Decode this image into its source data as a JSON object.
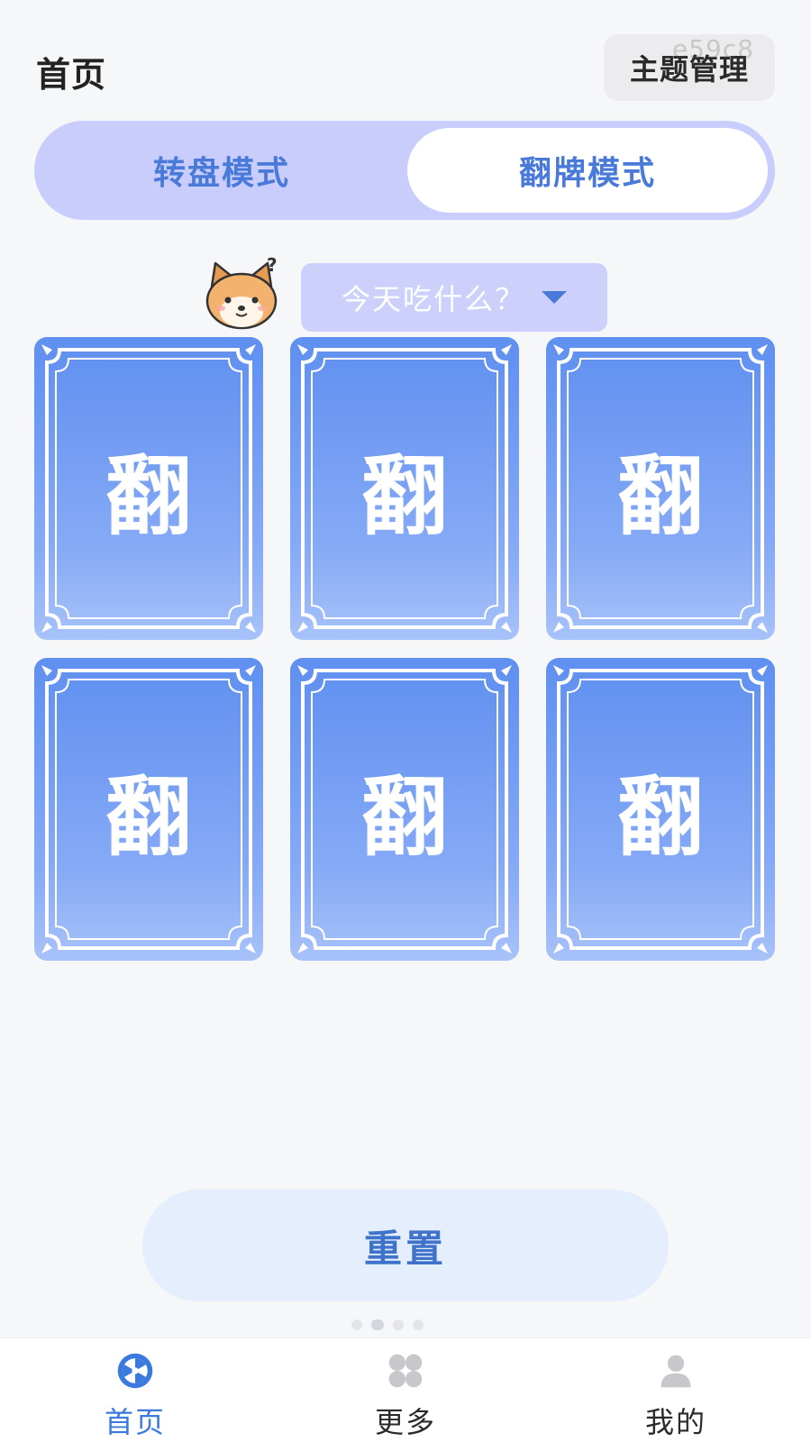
{
  "header": {
    "title": "首页",
    "theme_button": "主题管理",
    "watermark": "e59c8"
  },
  "mode_switch": {
    "tabs": [
      {
        "label": "转盘模式",
        "selected": false
      },
      {
        "label": "翻牌模式",
        "selected": true
      }
    ]
  },
  "question": {
    "mascot": "shiba-dog-icon",
    "mark": "?",
    "selected": "今天吃什么？"
  },
  "cards": [
    {
      "label": "翻"
    },
    {
      "label": "翻"
    },
    {
      "label": "翻"
    },
    {
      "label": "翻"
    },
    {
      "label": "翻"
    },
    {
      "label": "翻"
    }
  ],
  "reset_button": "重置",
  "tabbar": {
    "items": [
      {
        "label": "首页",
        "icon": "wheel-icon",
        "active": true
      },
      {
        "label": "更多",
        "icon": "grid-clover-icon",
        "active": false
      },
      {
        "label": "我的",
        "icon": "user-icon",
        "active": false
      }
    ]
  },
  "colors": {
    "accent": "#3a7adf",
    "switch_bg": "#c9cdfb",
    "card_top": "#5f8ff0",
    "card_bottom": "#a8c2fa"
  }
}
